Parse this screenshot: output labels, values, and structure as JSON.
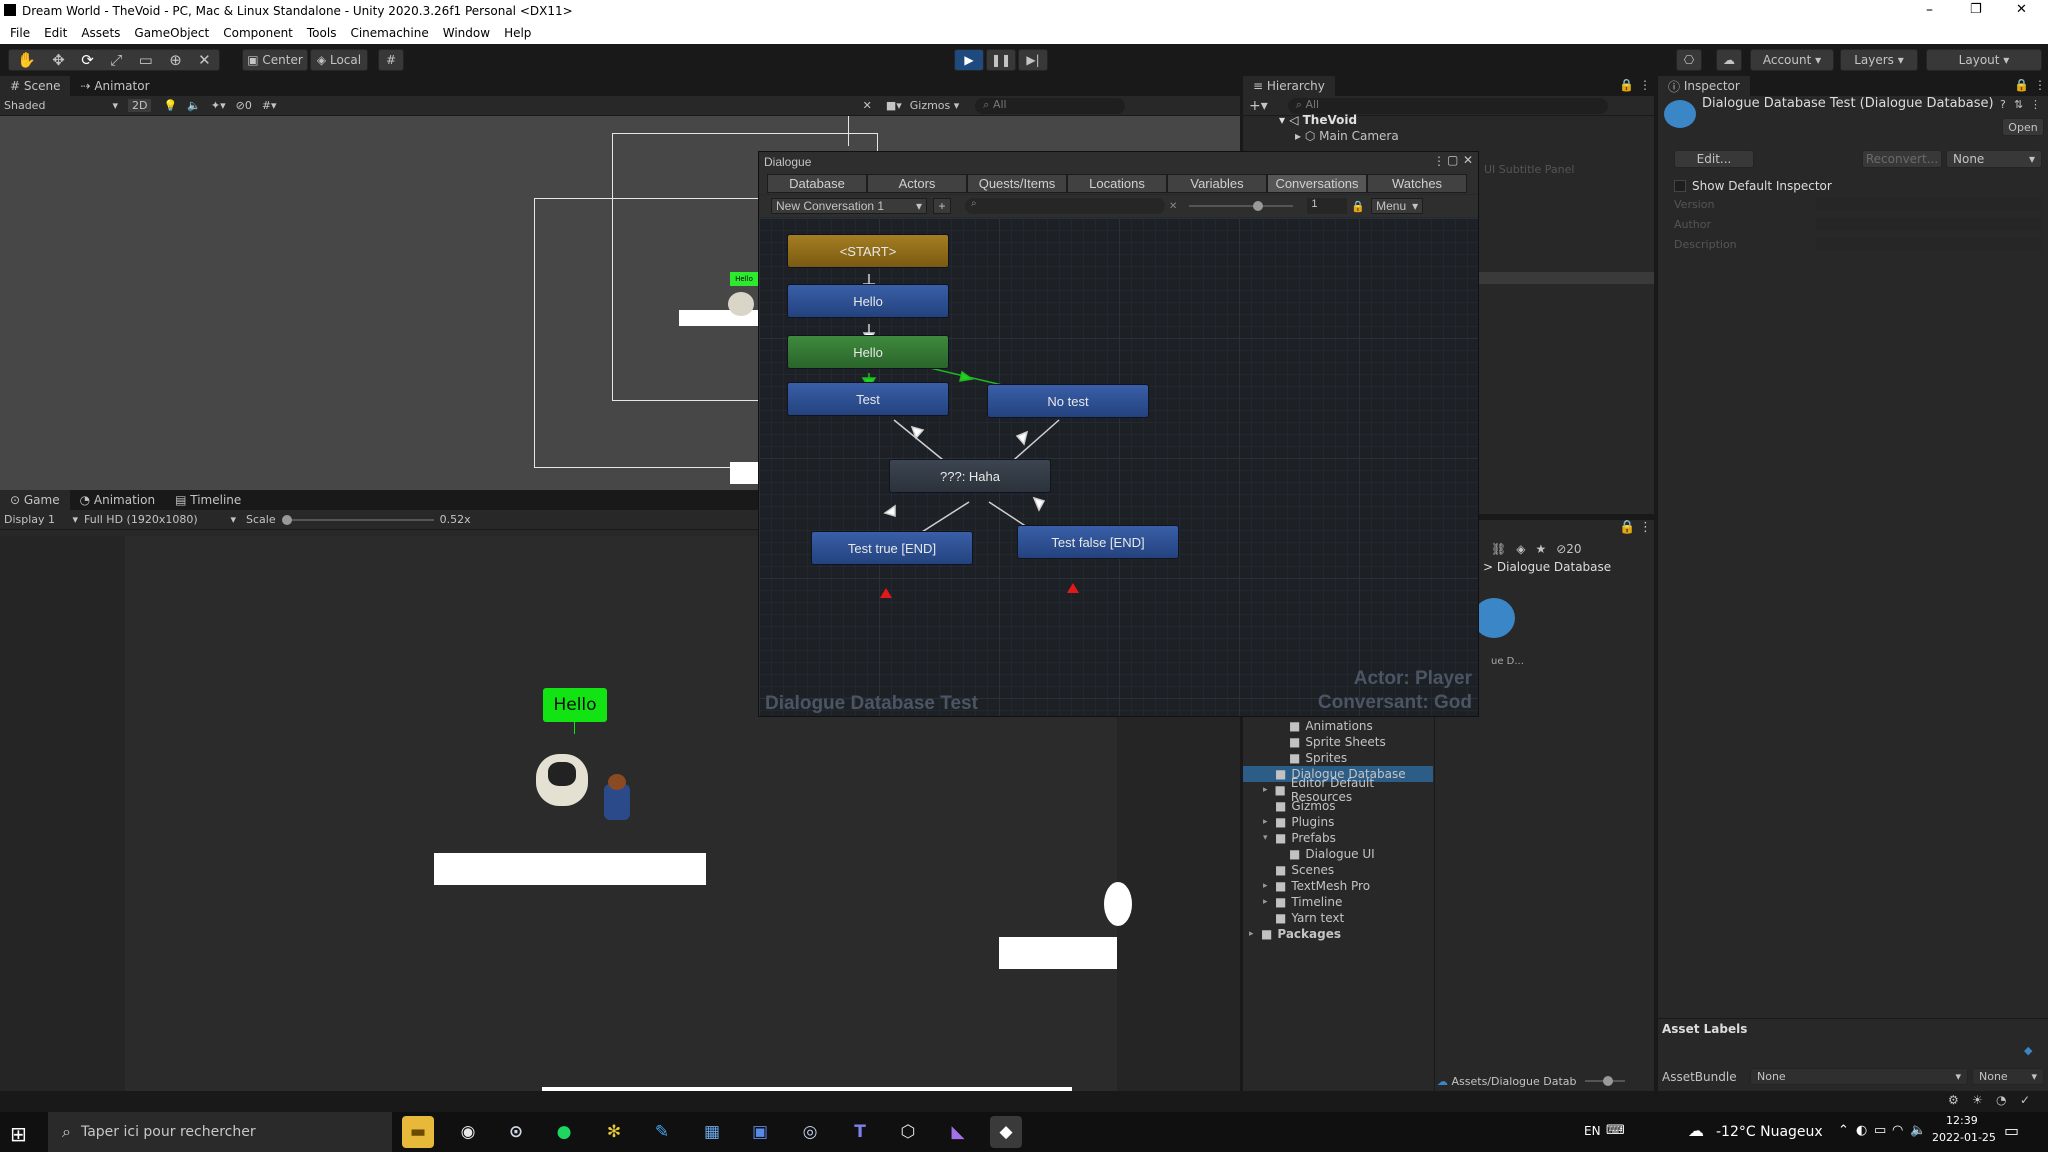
{
  "window": {
    "title": "Dream World - TheVoid - PC, Mac & Linux Standalone - Unity 2020.3.26f1 Personal <DX11>",
    "controls": [
      "–",
      "❐",
      "✕"
    ]
  },
  "menu": [
    "File",
    "Edit",
    "Assets",
    "GameObject",
    "Component",
    "Tools",
    "Cinemachine",
    "Window",
    "Help"
  ],
  "toolbar": {
    "pivot": "Center",
    "space": "Local",
    "account": "Account",
    "layers": "Layers",
    "layout": "Layout"
  },
  "scene": {
    "tabs": [
      "Scene",
      "Animator"
    ],
    "shading": "Shaded",
    "mode2d": "2D",
    "hidden_count": "0",
    "gizmos": "Gizmos",
    "search_placeholder": "All",
    "bubble_small": "Hello"
  },
  "game": {
    "tabs": [
      "Game",
      "Animation",
      "Timeline"
    ],
    "display": "Display 1",
    "resolution": "Full HD (1920x1080)",
    "scale_label": "Scale",
    "scale_value": "0.52x",
    "bubble": "Hello"
  },
  "hierarchy": {
    "tab": "Hierarchy",
    "search_placeholder": "All",
    "scene_name": "TheVoid",
    "items": [
      "Main Camera"
    ],
    "faded_item": "UI Subtitle Panel"
  },
  "dialogue": {
    "title": "Dialogue",
    "tabs": [
      "Database",
      "Actors",
      "Quests/Items",
      "Locations",
      "Variables",
      "Conversations",
      "Watches"
    ],
    "selected_tab": "Conversations",
    "conversation": "New Conversation 1",
    "add_label": "+",
    "zoom_value": "1",
    "menu": "Menu",
    "nodes": [
      {
        "id": "start",
        "label": "<START>"
      },
      {
        "id": "hello1",
        "label": "Hello"
      },
      {
        "id": "hello2",
        "label": "Hello"
      },
      {
        "id": "test",
        "label": "Test"
      },
      {
        "id": "notest",
        "label": "No test"
      },
      {
        "id": "haha",
        "label": "???: Haha"
      },
      {
        "id": "true",
        "label": "Test true [END]"
      },
      {
        "id": "false",
        "label": "Test false [END]"
      }
    ],
    "db_watermark": "Dialogue Database Test",
    "actor": "Actor: Player",
    "conversant": "Conversant: God"
  },
  "project": {
    "breadcrumb": "Dialogue Database",
    "asset_short": "ue D...",
    "hidden_count": "20",
    "tree": [
      {
        "label": "Animations",
        "indent": 2,
        "expand": false
      },
      {
        "label": "Sprite Sheets",
        "indent": 2,
        "expand": false
      },
      {
        "label": "Sprites",
        "indent": 2,
        "expand": false
      },
      {
        "label": "Dialogue Database",
        "indent": 1,
        "expand": false,
        "selected": true
      },
      {
        "label": "Editor Default Resources",
        "indent": 1,
        "expand": true
      },
      {
        "label": "Gizmos",
        "indent": 1,
        "expand": false
      },
      {
        "label": "Plugins",
        "indent": 1,
        "expand": true
      },
      {
        "label": "Prefabs",
        "indent": 1,
        "expand": true,
        "open": true
      },
      {
        "label": "Dialogue UI",
        "indent": 2,
        "expand": false
      },
      {
        "label": "Scenes",
        "indent": 1,
        "expand": false
      },
      {
        "label": "TextMesh Pro",
        "indent": 1,
        "expand": true
      },
      {
        "label": "Timeline",
        "indent": 1,
        "expand": true
      },
      {
        "label": "Yarn text",
        "indent": 1,
        "expand": false
      },
      {
        "label": "Packages",
        "indent": 0,
        "expand": true
      }
    ],
    "path": "Assets/Dialogue Datab"
  },
  "inspector": {
    "tab": "Inspector",
    "object": "Dialogue Database Test (Dialogue Database)",
    "open": "Open",
    "edit": "Edit...",
    "reconvert": "Reconvert...",
    "none": "None",
    "show_default": "Show Default Inspector",
    "fields": [
      "Version",
      "Author",
      "Description"
    ],
    "asset_labels": "Asset Labels",
    "assetbundle": "AssetBundle",
    "bundle_value": "None",
    "variant_value": "None"
  },
  "taskbar": {
    "search_placeholder": "Taper ici pour rechercher",
    "lang": "EN",
    "weather": "-12°C  Nuageux",
    "time": "12:39",
    "date": "2022-01-25"
  }
}
